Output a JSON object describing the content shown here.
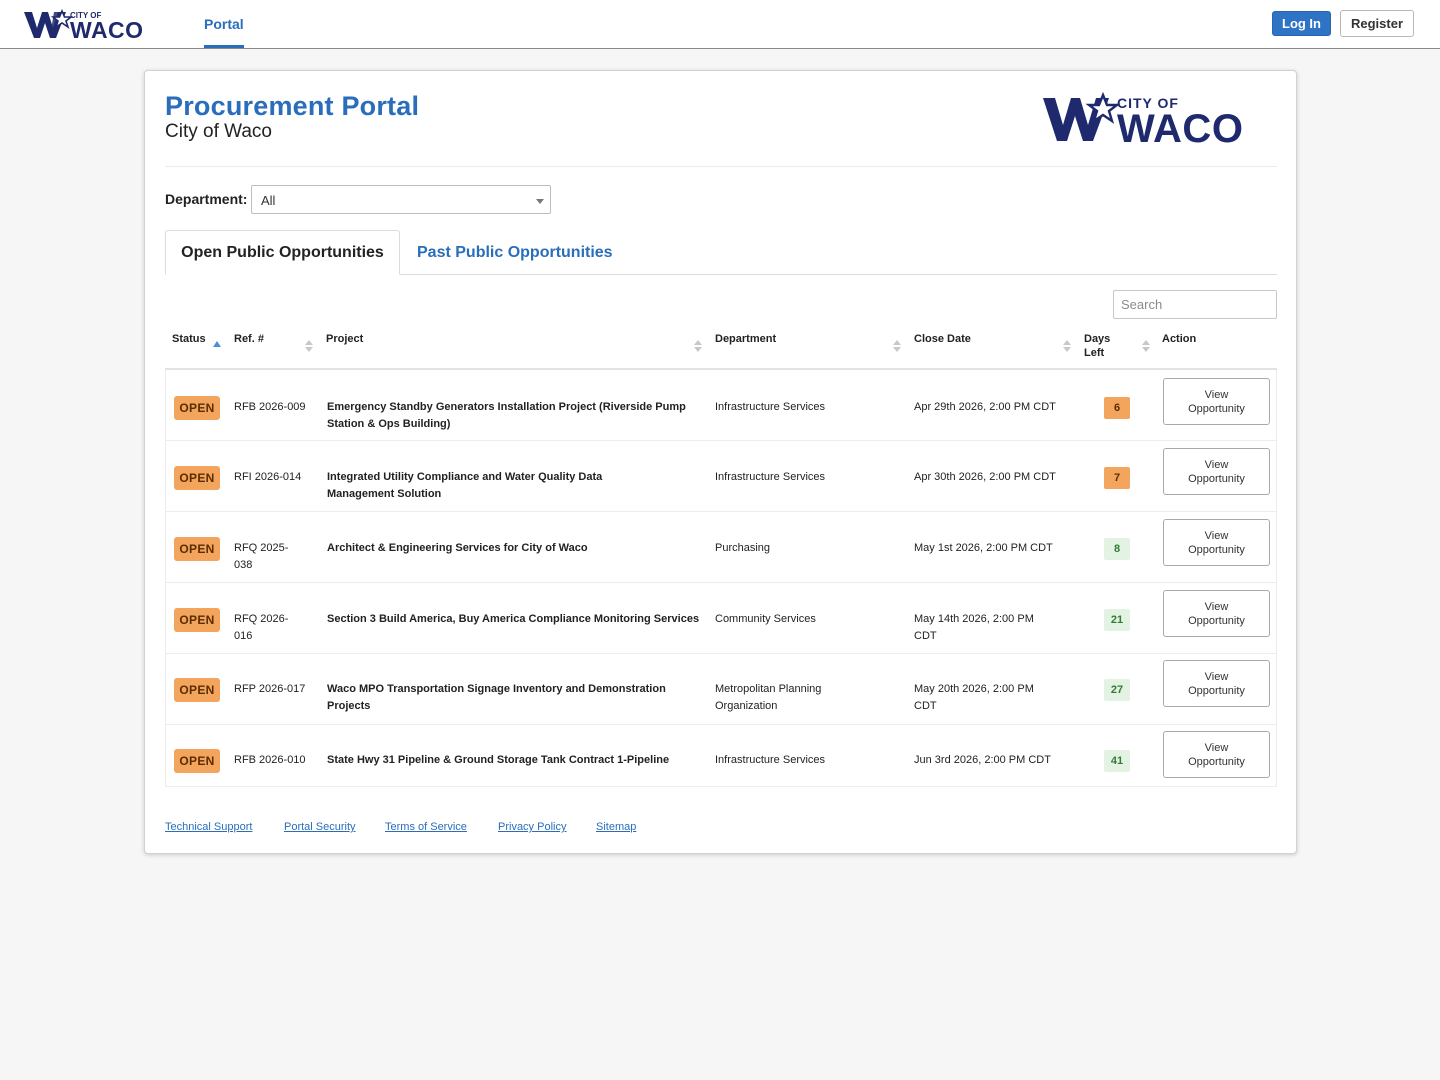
{
  "nav": {
    "logo_small_text": "CITY OF",
    "logo_big_text": "WACO",
    "portal_tab": "Portal",
    "login": "Log In",
    "register": "Register"
  },
  "header": {
    "title": "Procurement Portal",
    "subtitle": "City of Waco",
    "logo_small_text": "CITY OF",
    "logo_big_text": "WACO"
  },
  "filters": {
    "department_label": "Department:",
    "department_value": "All"
  },
  "tabs": [
    "Open Public Opportunities",
    "Past Public Opportunities"
  ],
  "search": {
    "placeholder": "Search"
  },
  "table": {
    "headers": {
      "status": "Status",
      "ref": "Ref. #",
      "project": "Project",
      "department": "Department",
      "close_date": "Close Date",
      "days_left": "Days Left",
      "action": "Action"
    },
    "rows": [
      {
        "status": "OPEN",
        "ref": "RFB 2026-009",
        "project": "Emergency Standby Generators Installation Project (Riverside Pump Station & Ops Building)",
        "department": "Infrastructure Services",
        "close_date": "Apr 29th 2026, 2:00 PM CDT",
        "days_left": "6",
        "days_color": "#f4a55d",
        "action": "View Opportunity"
      },
      {
        "status": "OPEN",
        "ref": "RFI 2026-014",
        "project": "Integrated Utility Compliance and Water Quality Data Management Solution",
        "department": "Infrastructure Services",
        "close_date": "Apr 30th 2026, 2:00 PM CDT",
        "days_left": "7",
        "days_color": "#f4a55d",
        "action": "View Opportunity"
      },
      {
        "status": "OPEN",
        "ref": "RFQ 2025-038",
        "project": "Architect & Engineering Services for City of Waco",
        "department": "Purchasing",
        "close_date": "May 1st 2026, 2:00 PM CDT",
        "days_left": "8",
        "days_color": "#e4f2e4",
        "action": "View Opportunity"
      },
      {
        "status": "OPEN",
        "ref": "RFQ 2026-016",
        "project": "Section 3 Build America, Buy America Compliance Monitoring Services",
        "department": "Community Services",
        "close_date": "May 14th 2026, 2:00 PM CDT",
        "days_left": "21",
        "days_color": "#e4f2e4",
        "action": "View Opportunity"
      },
      {
        "status": "OPEN",
        "ref": "RFP 2026-017",
        "project": "Waco MPO Transportation Signage Inventory and Demonstration Projects",
        "department": "Metropolitan Planning Organization",
        "close_date": "May 20th 2026, 2:00 PM CDT",
        "days_left": "27",
        "days_color": "#e4f2e4",
        "action": "View Opportunity"
      },
      {
        "status": "OPEN",
        "ref": "RFB 2026-010",
        "project": "State Hwy 31 Pipeline & Ground Storage Tank Contract 1-Pipeline",
        "department": "Infrastructure Services",
        "close_date": "Jun 3rd 2026, 2:00 PM CDT",
        "days_left": "41",
        "days_color": "#e4f2e4",
        "action": "View Opportunity"
      }
    ]
  },
  "footer": {
    "links": [
      "Technical Support",
      "Portal Security",
      "Terms of Service",
      "Privacy Policy",
      "Sitemap"
    ]
  },
  "colors": {
    "brand_navy": "#1f2a6e",
    "link_blue": "#2a6ebb",
    "open_badge": "#f4a55d",
    "days_green_text": "#2e7d32"
  }
}
